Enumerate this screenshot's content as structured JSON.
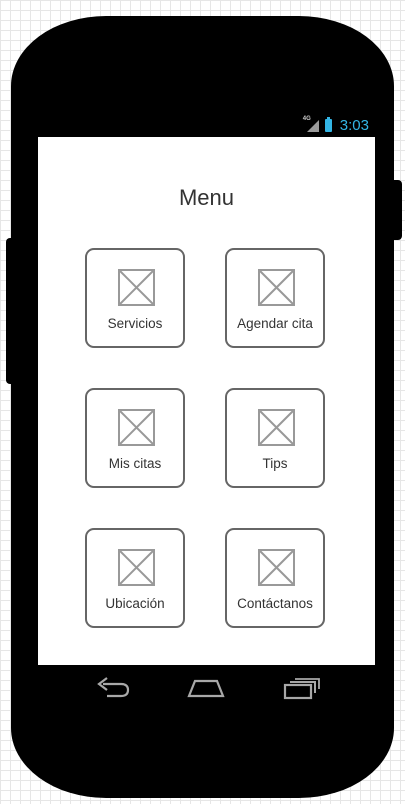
{
  "status_bar": {
    "network": "4G",
    "time": "3:03",
    "icons": [
      "signal-icon",
      "battery-icon"
    ],
    "accent_color": "#33b5e5"
  },
  "menu": {
    "title": "Menu",
    "items": [
      {
        "label": "Servicios",
        "icon": "image-placeholder-icon"
      },
      {
        "label": "Agendar cita",
        "icon": "image-placeholder-icon"
      },
      {
        "label": "Mis citas",
        "icon": "image-placeholder-icon"
      },
      {
        "label": "Tips",
        "icon": "image-placeholder-icon"
      },
      {
        "label": "Ubicación",
        "icon": "image-placeholder-icon"
      },
      {
        "label": "Contáctanos",
        "icon": "image-placeholder-icon"
      }
    ]
  },
  "nav_bar": {
    "buttons": [
      "back-icon",
      "home-icon",
      "recent-apps-icon"
    ]
  }
}
